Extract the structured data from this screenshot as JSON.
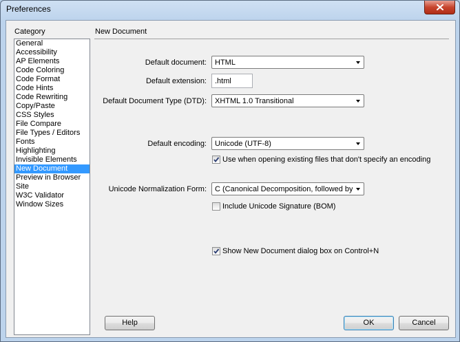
{
  "window": {
    "title": "Preferences"
  },
  "category": {
    "heading": "Category",
    "items": [
      "General",
      "Accessibility",
      "AP Elements",
      "Code Coloring",
      "Code Format",
      "Code Hints",
      "Code Rewriting",
      "Copy/Paste",
      "CSS Styles",
      "File Compare",
      "File Types / Editors",
      "Fonts",
      "Highlighting",
      "Invisible Elements",
      "New Document",
      "Preview in Browser",
      "Site",
      "W3C Validator",
      "Window Sizes"
    ],
    "selected": "New Document"
  },
  "panel": {
    "title": "New Document",
    "default_document": {
      "label": "Default document:",
      "value": "HTML"
    },
    "default_extension": {
      "label": "Default extension:",
      "value": ".html"
    },
    "doc_type": {
      "label": "Default Document Type (DTD):",
      "value": "XHTML 1.0 Transitional"
    },
    "encoding": {
      "label": "Default encoding:",
      "value": "Unicode (UTF-8)"
    },
    "use_encoding_checkbox": {
      "label": "Use when opening existing files that don't specify an encoding",
      "checked": true
    },
    "normalization": {
      "label": "Unicode Normalization Form:",
      "value": "C (Canonical Decomposition, followed by Canonical Composition)"
    },
    "unicode_signature_checkbox": {
      "label": "Include Unicode Signature (BOM)",
      "checked": false
    },
    "show_dialog_checkbox": {
      "label": "Show New Document dialog box on Control+N",
      "checked": true
    }
  },
  "buttons": {
    "help": "Help",
    "ok": "OK",
    "cancel": "Cancel"
  },
  "colors": {
    "selection": "#3399ff",
    "frame": "#bcd3ec",
    "close": "#c7452e"
  },
  "icons": [
    "close-icon",
    "dropdown-arrow-icon",
    "checkmark-icon"
  ]
}
